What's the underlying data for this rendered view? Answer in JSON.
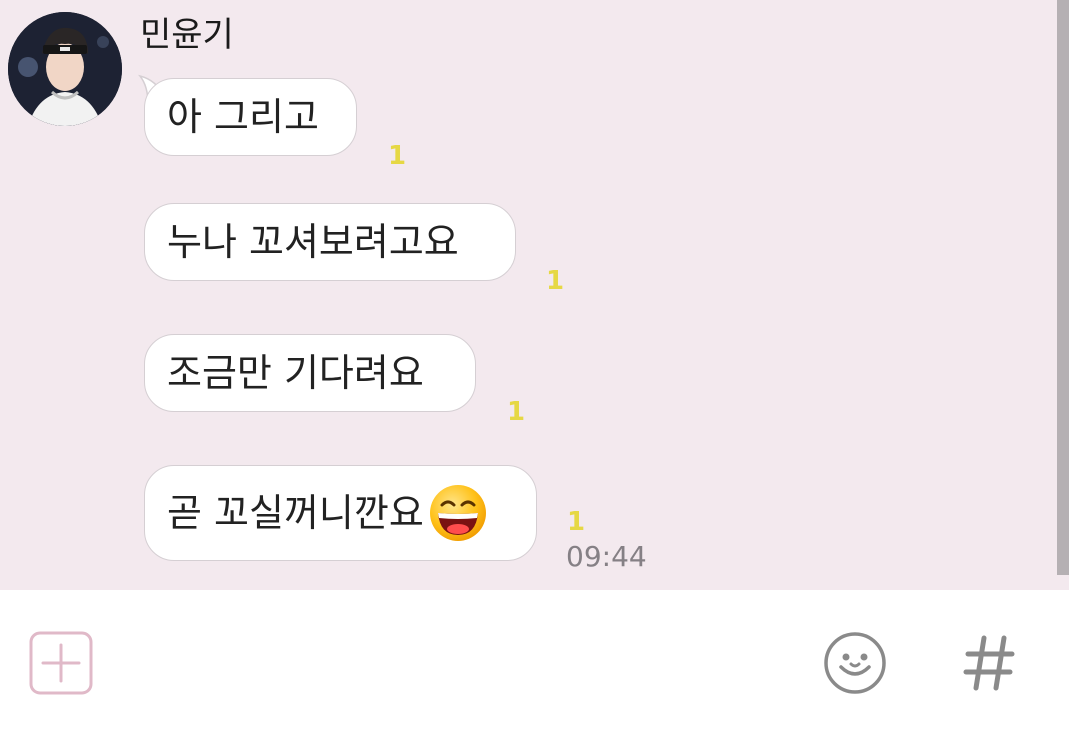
{
  "sender": {
    "name": "민윤기"
  },
  "messages": [
    {
      "text": "아 그리고",
      "unread": "1"
    },
    {
      "text": "누나 꼬셔보려고요",
      "unread": "1"
    },
    {
      "text": "조금만 기다려요",
      "unread": "1"
    },
    {
      "text": "곧 꼬실꺼니깐요",
      "unread": "1",
      "time": "09:44",
      "emoji": "grinning-face-emoji"
    }
  ],
  "input_bar": {
    "icons": [
      "plus-icon",
      "emoji-icon",
      "hash-icon"
    ]
  },
  "colors": {
    "chat_background": "#f3e9ee",
    "unread_counter": "#e6d844",
    "plus_icon": "#e0b9c8",
    "icon_gray": "#8a8a8a"
  }
}
